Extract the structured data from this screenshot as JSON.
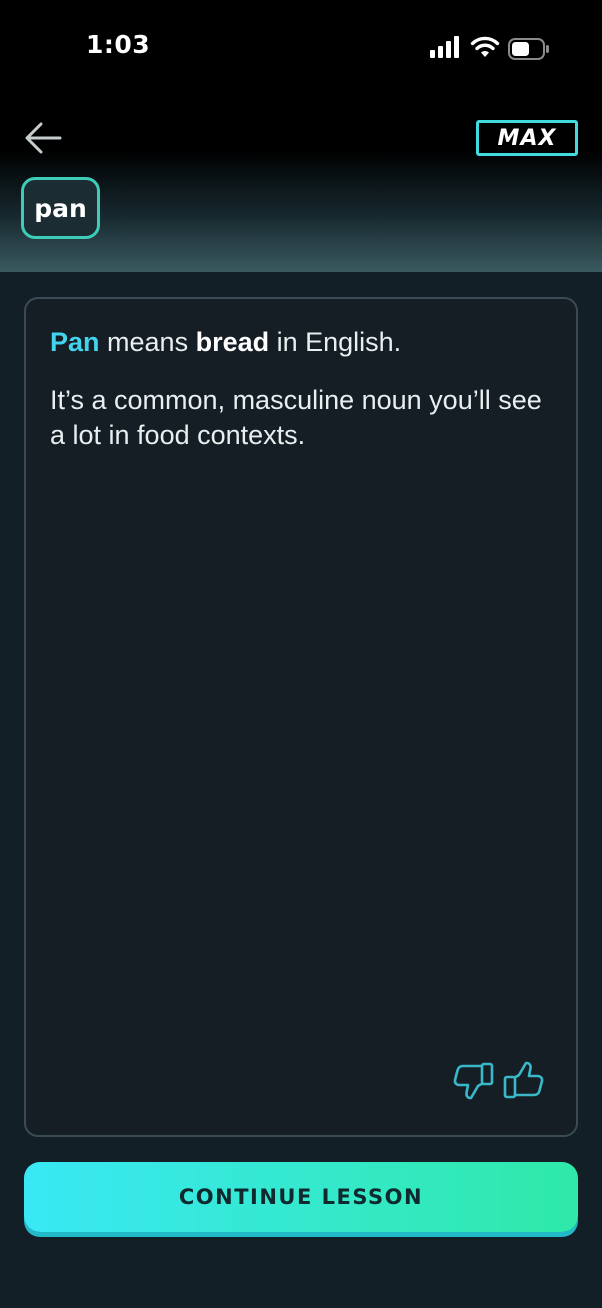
{
  "status_bar": {
    "time": "1:03",
    "icons": [
      "signal-icon",
      "wifi-icon",
      "battery-icon"
    ]
  },
  "header": {
    "back_icon": "arrow-left-icon",
    "badge_label": "MAX",
    "word_chip": "pan"
  },
  "card": {
    "line1": {
      "highlight_word": "Pan",
      "text_a": " means ",
      "bold_word": "bread",
      "text_b": " in English."
    },
    "line2": "It’s a common, masculine noun you’ll see a lot in food contexts.",
    "feedback_icons": [
      "thumbs-down-icon",
      "thumbs-up-icon"
    ]
  },
  "footer": {
    "continue_label": "CONTINUE LESSON"
  },
  "colors": {
    "accent_cyan": "#42d4ee",
    "accent_teal": "#3ecbb8",
    "button_gradient_start": "#39e8f5",
    "button_gradient_end": "#2ee9a8",
    "background": "#131f26"
  }
}
